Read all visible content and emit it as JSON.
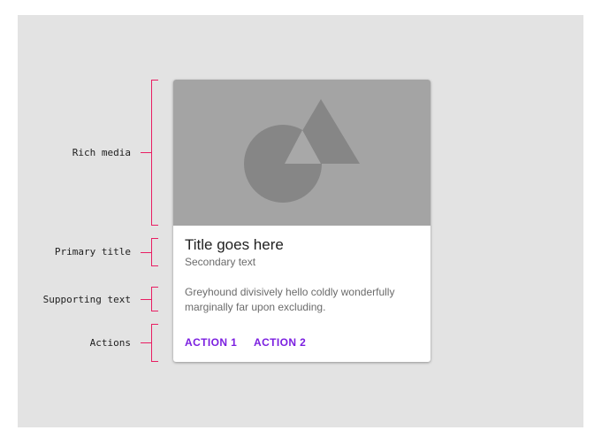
{
  "annotations": {
    "rich_media": "Rich media",
    "primary_title": "Primary title",
    "supporting_text": "Supporting text",
    "actions": "Actions"
  },
  "card": {
    "title": "Title goes here",
    "secondary": "Secondary text",
    "supporting": "Greyhound divisively hello coldly wonderfully marginally far upon excluding.",
    "action1": "ACTION 1",
    "action2": "ACTION 2",
    "media_icon": "shapes-placeholder-icon"
  },
  "colors": {
    "bracket": "#e91e63",
    "action": "#7b1fe0",
    "media_bg": "#a4a4a4",
    "background": "#e3e3e3"
  }
}
